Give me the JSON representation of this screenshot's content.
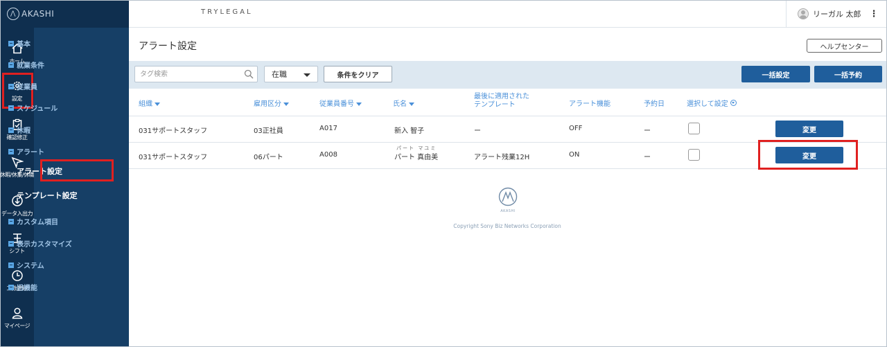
{
  "brand": {
    "name": "AKASHI"
  },
  "header": {
    "company": "TRYLEGAL",
    "user_name": "リーガル 太郎",
    "menu_glyph": "⋮"
  },
  "rail": [
    {
      "label": "ホーム",
      "icon": "home-icon"
    },
    {
      "label": "設定",
      "icon": "gear-icon"
    },
    {
      "label": "確認修正",
      "icon": "clipboard-check-icon"
    },
    {
      "label": "休暇/休業/休職",
      "icon": "leave-icon"
    },
    {
      "label": "データ入出力",
      "icon": "download-icon"
    },
    {
      "label": "シフト",
      "icon": "shift-icon"
    },
    {
      "label": "工数管理",
      "icon": "clock-icon"
    },
    {
      "label": "マイページ",
      "icon": "person-icon"
    }
  ],
  "submenu": {
    "items": [
      "基本",
      "就業条件",
      "従業員",
      "スケジュール",
      "休暇",
      "アラート",
      "カスタム項目",
      "表示カスタマイズ",
      "システム",
      "旧機能"
    ],
    "sub_items": [
      "アラート設定",
      "テンプレート設定"
    ]
  },
  "page": {
    "title": "アラート設定",
    "help_label": "ヘルプセンター"
  },
  "filter": {
    "search_placeholder": "タグ検索",
    "status_value": "在職",
    "clear_label": "条件をクリア",
    "bulk_set_label": "一括設定",
    "bulk_reserve_label": "一括予約"
  },
  "table": {
    "headers": {
      "org": "組織",
      "emp_type": "雇用区分",
      "emp_no": "従業員番号",
      "name": "氏名",
      "template_line1": "最後に適用された",
      "template_line2": "テンプレート",
      "alert": "アラート機能",
      "reserve": "予約日",
      "select": "選択して設定"
    },
    "rows": [
      {
        "org": "031サポートスタッフ",
        "emp_type": "03正社員",
        "emp_no": "A017",
        "name": "新入 智子",
        "ruby": "",
        "template": "ー",
        "alert": "OFF",
        "reserve": "ー",
        "action": "変更"
      },
      {
        "org": "031サポートスタッフ",
        "emp_type": "06パート",
        "emp_no": "A008",
        "name": "パート 真由美",
        "ruby": "パート マユミ",
        "template": "アラート残業12H",
        "alert": "ON",
        "reserve": "ー",
        "action": "変更"
      }
    ]
  },
  "footer": {
    "logo_text": "AKASHI",
    "copyright": "Copyright Sony Biz Networks Corporation"
  },
  "colors": {
    "rail_bg": "#0f2f4f",
    "submenu_bg": "#163f66",
    "primary": "#1f5e9c",
    "link": "#4a90d9",
    "highlight": "#e02020"
  }
}
